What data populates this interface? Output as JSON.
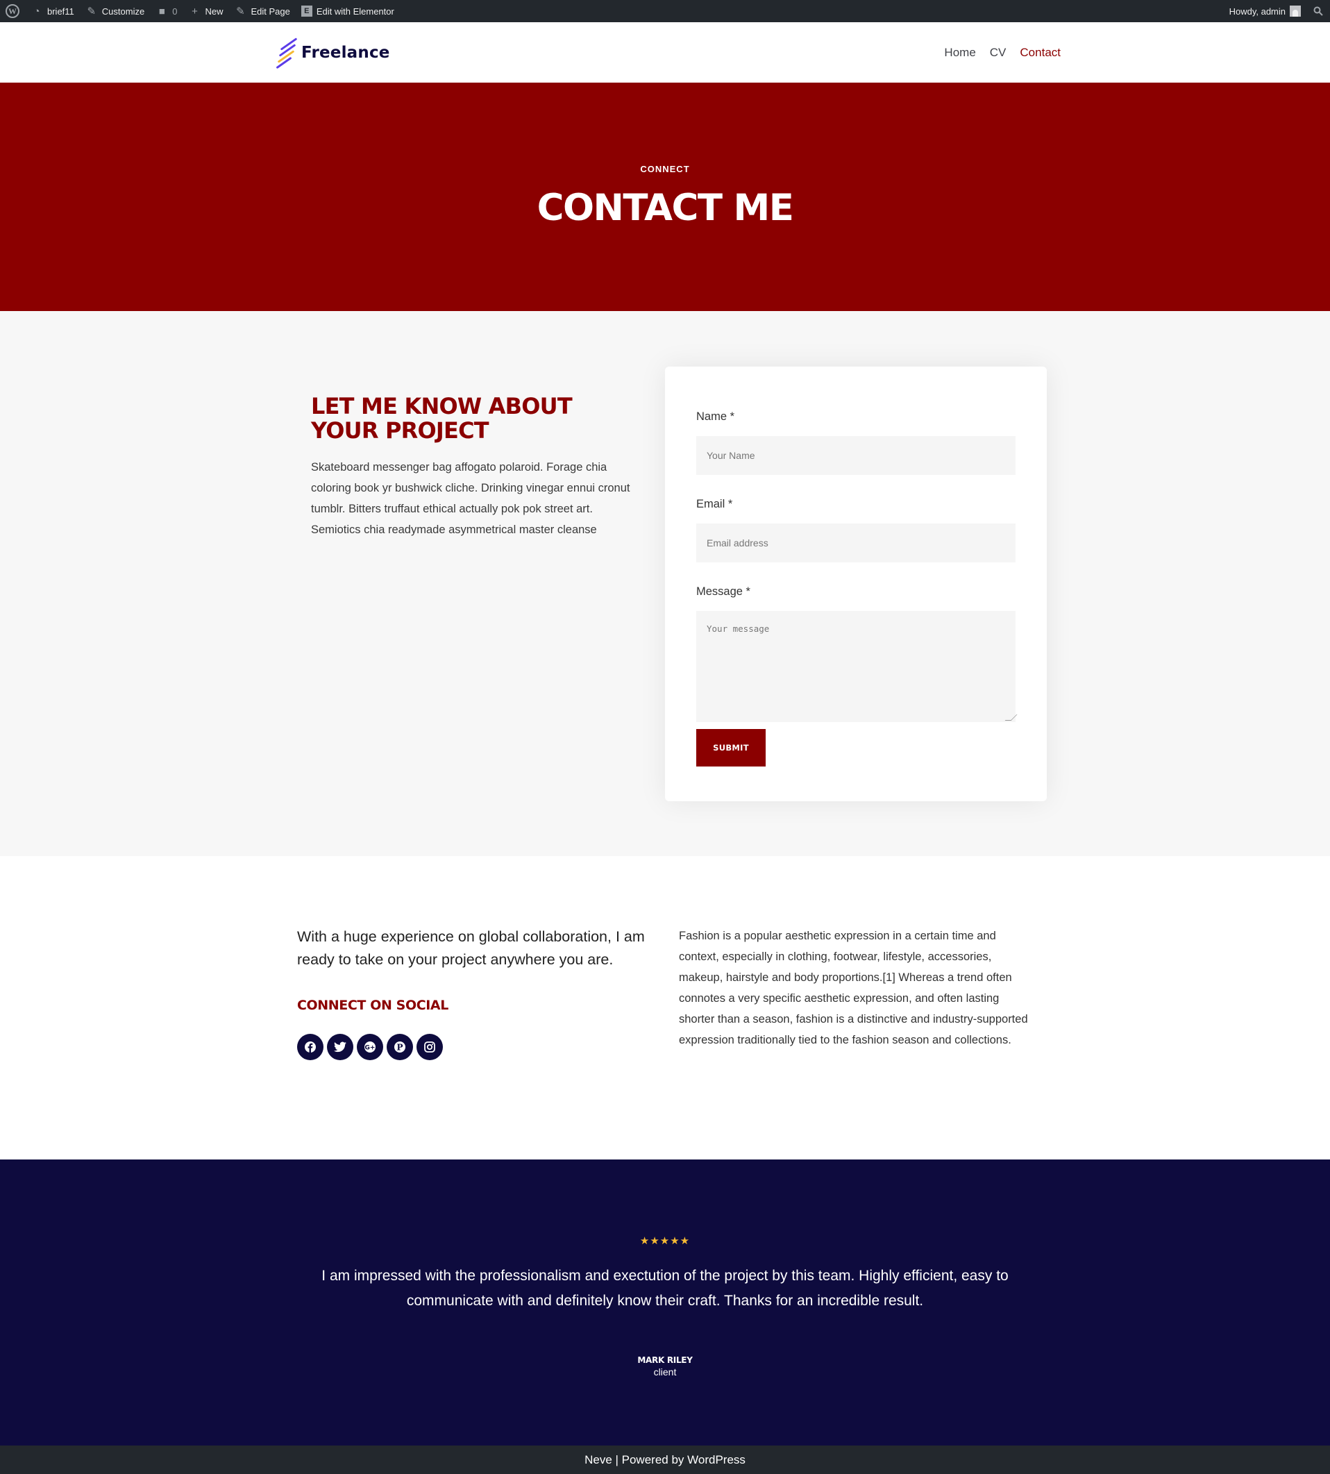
{
  "adminbar": {
    "site": "brief11",
    "customize": "Customize",
    "comments": "0",
    "new": "New",
    "edit_page": "Edit Page",
    "edit_elementor": "Edit with Elementor",
    "howdy": "Howdy, admin"
  },
  "header": {
    "logo": "Freelance",
    "nav": [
      "Home",
      "CV",
      "Contact"
    ]
  },
  "hero": {
    "kicker": "CONNECT",
    "title": "CONTACT ME"
  },
  "contact": {
    "heading": "LET ME KNOW ABOUT YOUR PROJECT",
    "body": "Skateboard messenger bag affogato polaroid. Forage chia coloring book yr bushwick cliche. Drinking vinegar ennui cronut tumblr. Bitters truffaut ethical actually pok pok street art. Semiotics chia readymade asymmetrical master cleanse",
    "form": {
      "name_label": "Name *",
      "name_placeholder": "Your Name",
      "email_label": "Email *",
      "email_placeholder": "Email address",
      "message_label": "Message *",
      "message_placeholder": "Your message",
      "submit": "SUBMIT"
    }
  },
  "about": {
    "lead": "With a huge experience on global collaboration, I am ready to take on your project anywhere you are.",
    "social_heading": "CONNECT ON SOCIAL",
    "socials": [
      "facebook-icon",
      "twitter-icon",
      "google-plus-icon",
      "pinterest-icon",
      "instagram-icon"
    ],
    "body": "Fashion is a popular aesthetic expression in a certain time and context, especially in clothing, footwear, lifestyle, accessories, makeup, hairstyle and body proportions.[1] Whereas a trend often connotes a very specific aesthetic expression, and often lasting shorter than a season, fashion is a distinctive and industry-supported expression traditionally tied to the fashion season and collections."
  },
  "testimonial": {
    "stars": "★★★★★",
    "rating": 5,
    "quote": "I am impressed with the professionalism and exectution of the project by this team. Highly efficient, easy to communicate with and definitely know their craft. Thanks for an incredible result.",
    "author": "MARK RILEY",
    "role": "client"
  },
  "footer": {
    "text": "Neve | Powered by WordPress"
  },
  "colors": {
    "accent": "#8b0000",
    "navy": "#0e0b3e",
    "admin_bar": "#23282d"
  }
}
